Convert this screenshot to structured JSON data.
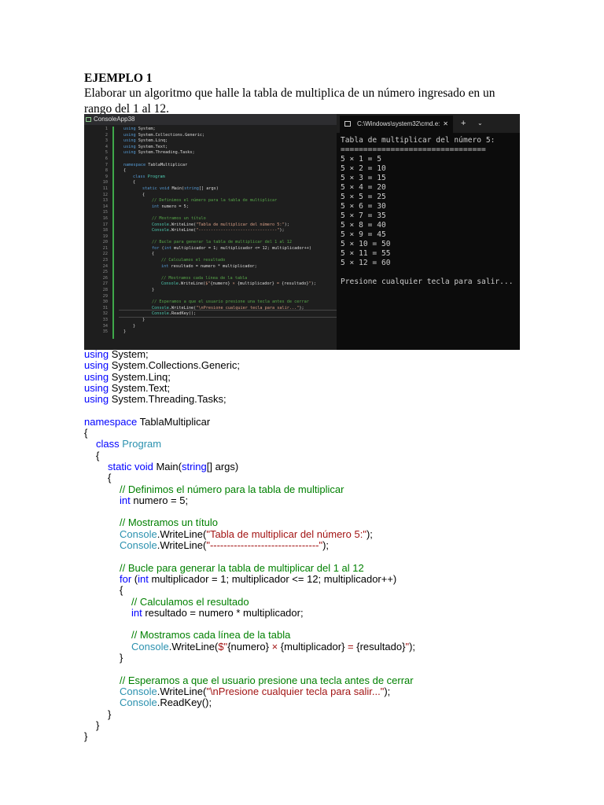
{
  "heading": "EJEMPLO 1",
  "paragraph": "Elaborar un algoritmo que halle la tabla de multiplica de un número ingresado en un rango del 1 al 12.",
  "editor": {
    "title": "ConsoleApp38"
  },
  "console": {
    "tab_title": "C:\\Windows\\system32\\cmd.e:",
    "close": "✕",
    "plus": "+",
    "chevron": "⌄",
    "lines": [
      "Tabla de multiplicar del número 5:",
      "================================",
      "5 × 1 = 5",
      "5 × 2 = 10",
      "5 × 3 = 15",
      "5 × 4 = 20",
      "5 × 5 = 25",
      "5 × 6 = 30",
      "5 × 7 = 35",
      "5 × 8 = 40",
      "5 × 9 = 45",
      "5 × 10 = 50",
      "5 × 11 = 55",
      "5 × 12 = 60",
      "",
      "Presione cualquier tecla para salir..."
    ]
  },
  "code": [
    {
      "indent": 0,
      "tokens": [
        [
          "kw",
          "using"
        ],
        [
          "plain",
          " System;"
        ]
      ]
    },
    {
      "indent": 0,
      "tokens": [
        [
          "kw",
          "using"
        ],
        [
          "plain",
          " System.Collections.Generic;"
        ]
      ]
    },
    {
      "indent": 0,
      "tokens": [
        [
          "kw",
          "using"
        ],
        [
          "plain",
          " System.Linq;"
        ]
      ]
    },
    {
      "indent": 0,
      "tokens": [
        [
          "kw",
          "using"
        ],
        [
          "plain",
          " System.Text;"
        ]
      ]
    },
    {
      "indent": 0,
      "tokens": [
        [
          "kw",
          "using"
        ],
        [
          "plain",
          " System.Threading.Tasks;"
        ]
      ]
    },
    {
      "indent": 0,
      "tokens": []
    },
    {
      "indent": 0,
      "tokens": [
        [
          "kw",
          "namespace"
        ],
        [
          "plain",
          " TablaMultiplicar"
        ]
      ]
    },
    {
      "indent": 0,
      "tokens": [
        [
          "plain",
          "{"
        ]
      ]
    },
    {
      "indent": 1,
      "tokens": [
        [
          "kw",
          "class"
        ],
        [
          "plain",
          " "
        ],
        [
          "type",
          "Program"
        ]
      ]
    },
    {
      "indent": 1,
      "tokens": [
        [
          "plain",
          "{"
        ]
      ]
    },
    {
      "indent": 2,
      "tokens": [
        [
          "kw",
          "static"
        ],
        [
          "plain",
          " "
        ],
        [
          "kw",
          "void"
        ],
        [
          "plain",
          " Main("
        ],
        [
          "kw",
          "string"
        ],
        [
          "plain",
          "[] args)"
        ]
      ]
    },
    {
      "indent": 2,
      "tokens": [
        [
          "plain",
          "{"
        ]
      ]
    },
    {
      "indent": 3,
      "tokens": [
        [
          "cmt",
          "// Definimos el número para la tabla de multiplicar"
        ]
      ]
    },
    {
      "indent": 3,
      "tokens": [
        [
          "kw",
          "int"
        ],
        [
          "plain",
          " numero = 5;"
        ]
      ]
    },
    {
      "indent": 0,
      "tokens": []
    },
    {
      "indent": 3,
      "tokens": [
        [
          "cmt",
          "// Mostramos un título"
        ]
      ]
    },
    {
      "indent": 3,
      "tokens": [
        [
          "type",
          "Console"
        ],
        [
          "plain",
          ".WriteLine("
        ],
        [
          "str",
          "\"Tabla de multiplicar del número 5:\""
        ],
        [
          "plain",
          ");"
        ]
      ]
    },
    {
      "indent": 3,
      "tokens": [
        [
          "type",
          "Console"
        ],
        [
          "plain",
          ".WriteLine("
        ],
        [
          "str",
          "\"--------------------------------\""
        ],
        [
          "plain",
          ");"
        ]
      ]
    },
    {
      "indent": 0,
      "tokens": []
    },
    {
      "indent": 3,
      "tokens": [
        [
          "cmt",
          "// Bucle para generar la tabla de multiplicar del 1 al 12"
        ]
      ]
    },
    {
      "indent": 3,
      "tokens": [
        [
          "kw",
          "for"
        ],
        [
          "plain",
          " ("
        ],
        [
          "kw",
          "int"
        ],
        [
          "plain",
          " multiplicador = 1; multiplicador <= 12; multiplicador++)"
        ]
      ]
    },
    {
      "indent": 3,
      "tokens": [
        [
          "plain",
          "{"
        ]
      ]
    },
    {
      "indent": 4,
      "tokens": [
        [
          "cmt",
          "// Calculamos el resultado"
        ]
      ]
    },
    {
      "indent": 4,
      "tokens": [
        [
          "kw",
          "int"
        ],
        [
          "plain",
          " resultado = numero * multiplicador;"
        ]
      ]
    },
    {
      "indent": 0,
      "tokens": []
    },
    {
      "indent": 4,
      "tokens": [
        [
          "cmt",
          "// Mostramos cada línea de la tabla"
        ]
      ]
    },
    {
      "indent": 4,
      "tokens": [
        [
          "type",
          "Console"
        ],
        [
          "plain",
          ".WriteLine("
        ],
        [
          "str",
          "$\""
        ],
        [
          "plain",
          "{numero}"
        ],
        [
          "str",
          " × "
        ],
        [
          "plain",
          "{multiplicador}"
        ],
        [
          "str",
          " = "
        ],
        [
          "plain",
          "{resultado}"
        ],
        [
          "str",
          "\""
        ],
        [
          "plain",
          ");"
        ]
      ]
    },
    {
      "indent": 3,
      "tokens": [
        [
          "plain",
          "}"
        ]
      ]
    },
    {
      "indent": 0,
      "tokens": []
    },
    {
      "indent": 3,
      "tokens": [
        [
          "cmt",
          "// Esperamos a que el usuario presione una tecla antes de cerrar"
        ]
      ]
    },
    {
      "indent": 3,
      "tokens": [
        [
          "type",
          "Console"
        ],
        [
          "plain",
          ".WriteLine("
        ],
        [
          "str",
          "\"\\nPresione cualquier tecla para salir...\""
        ],
        [
          "plain",
          ");"
        ]
      ]
    },
    {
      "indent": 3,
      "tokens": [
        [
          "type",
          "Console"
        ],
        [
          "plain",
          ".ReadKey();"
        ]
      ]
    },
    {
      "indent": 2,
      "tokens": [
        [
          "plain",
          "}"
        ]
      ]
    },
    {
      "indent": 1,
      "tokens": [
        [
          "plain",
          "}"
        ]
      ]
    },
    {
      "indent": 0,
      "tokens": [
        [
          "plain",
          "}"
        ]
      ]
    }
  ]
}
